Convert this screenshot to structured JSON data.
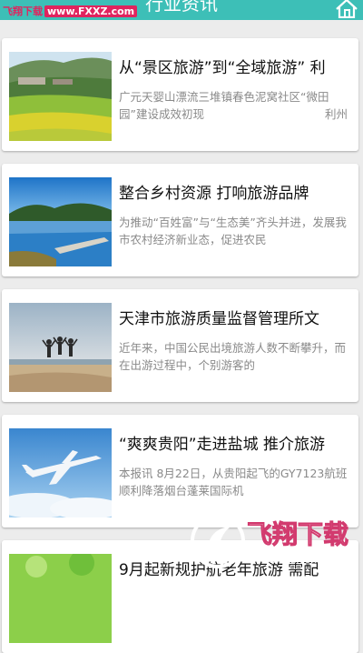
{
  "header": {
    "title": "行业资讯",
    "watermark_site": "飞翔下载",
    "watermark_url": "www.FXXZ.com"
  },
  "articles": [
    {
      "title": "从“景区旅游”到“全域旅游” 利",
      "summary": "广元天婴山漂流三堆镇春色泥窝社区“微田园”建设成效初现",
      "place": "利州",
      "image": "rural-landscape"
    },
    {
      "title": "整合乡村资源 打响旅游品牌",
      "summary": "为推动“百姓富”与“生态美”齐头并进，发展我市农村经济新业态，促进农民",
      "image": "lake-pier"
    },
    {
      "title": "天津市旅游质量监督管理所文",
      "summary": "近年来，中国公民出境旅游人数不断攀升，而在出游过程中，个别游客的",
      "image": "beach-jumping"
    },
    {
      "title": "“爽爽贵阳”走进盐城 推介旅游",
      "summary": "本报讯 8月22日，从贵阳起飞的GY7123航班顺利降落烟台蓬莱国际机",
      "image": "airplane-sky"
    },
    {
      "title": "9月起新规护航老年旅游 需配",
      "summary": "",
      "image": "green-field"
    }
  ],
  "overlay": {
    "brand_text": "飞翔下载",
    "brand_url": "www.fxxz.com"
  },
  "colors": {
    "header": "#3dbfb7",
    "watermark": "#e0245e",
    "title_text": "#111111",
    "summary_text": "#8a8a8a"
  }
}
